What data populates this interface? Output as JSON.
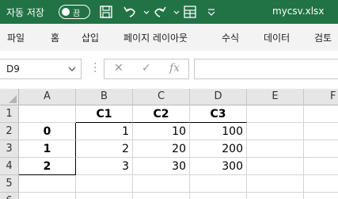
{
  "title_bar": {
    "autosave_label": "자동 저장",
    "autosave_state": "끔",
    "filename": "mycsv.xlsx",
    "icons": [
      "save-icon",
      "undo-icon",
      "redo-icon",
      "customize-icon"
    ]
  },
  "ribbon": {
    "tabs": [
      "파일",
      "홈",
      "삽입",
      "페이지 레이아웃",
      "수식",
      "데이터",
      "검토"
    ]
  },
  "formula_bar": {
    "name_box": "D9",
    "cancel_symbol": "✕",
    "enter_symbol": "✓",
    "fx_symbol": "fx",
    "formula": ""
  },
  "sheet": {
    "columns": [
      "A",
      "B",
      "C",
      "D",
      "E",
      "F"
    ],
    "rows": [
      "1",
      "2",
      "3",
      "4",
      "5",
      "6"
    ],
    "cells": {
      "B1": "C1",
      "C1": "C2",
      "D1": "C3",
      "A2": "0",
      "B2": "1",
      "C2": "10",
      "D2": "100",
      "A3": "1",
      "B3": "2",
      "C3": "20",
      "D3": "200",
      "A4": "2",
      "B4": "3",
      "C4": "30",
      "D4": "300"
    }
  },
  "colors": {
    "title_bar": "#217346",
    "ribbon": "#f3f3f3",
    "header": "#e6e6e6",
    "gridline": "#d4d4d4"
  }
}
